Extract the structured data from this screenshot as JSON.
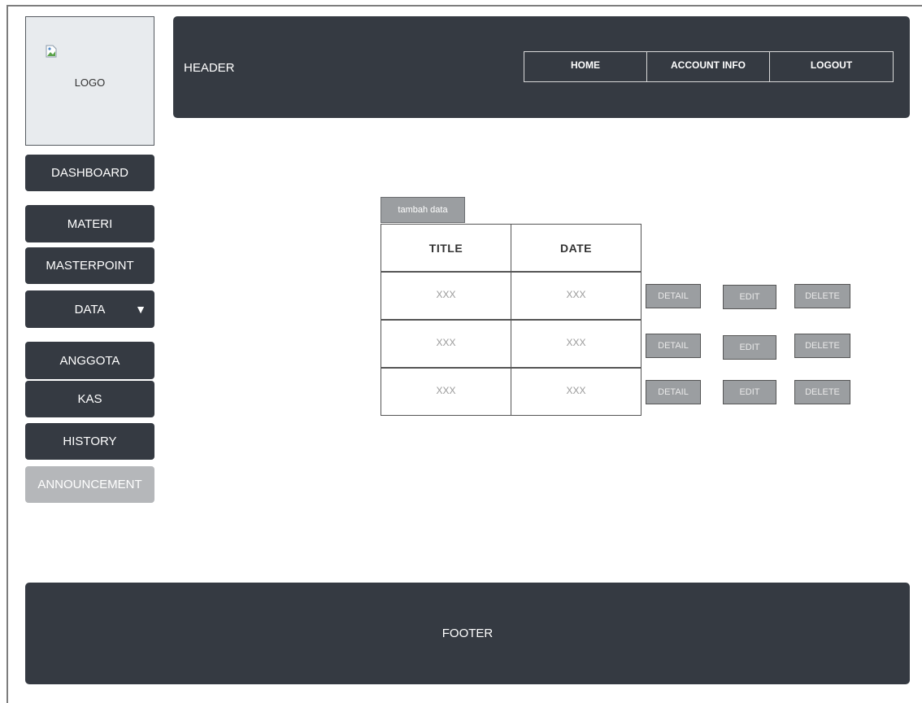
{
  "logo": {
    "label": "LOGO"
  },
  "header": {
    "title": "HEADER",
    "nav": [
      "HOME",
      "ACCOUNT INFO",
      "LOGOUT"
    ]
  },
  "sidebar": {
    "items": [
      {
        "label": "DASHBOARD"
      },
      {
        "label": "MATERI"
      },
      {
        "label": "MASTERPOINT"
      },
      {
        "label": "DATA",
        "caret": "▼"
      },
      {
        "label": "ANGGOTA"
      },
      {
        "label": "KAS"
      },
      {
        "label": "HISTORY"
      },
      {
        "label": "ANNOUNCEMENT",
        "state": "disabled"
      }
    ]
  },
  "main": {
    "add_button": "tambah data",
    "table": {
      "headers": [
        "TITLE",
        "DATE"
      ],
      "rows": [
        [
          "XXX",
          "XXX"
        ],
        [
          "XXX",
          "XXX"
        ],
        [
          "XXX",
          "XXX"
        ]
      ]
    },
    "row_actions": [
      "DETAIL",
      "EDIT",
      "DELETE"
    ]
  },
  "footer": {
    "label": "FOOTER"
  },
  "colors": {
    "dark_panel": "#353a42",
    "disabled_button": "#b5b7ba",
    "action_button": "#9b9ea1",
    "logo_bg": "#e8ebee"
  }
}
